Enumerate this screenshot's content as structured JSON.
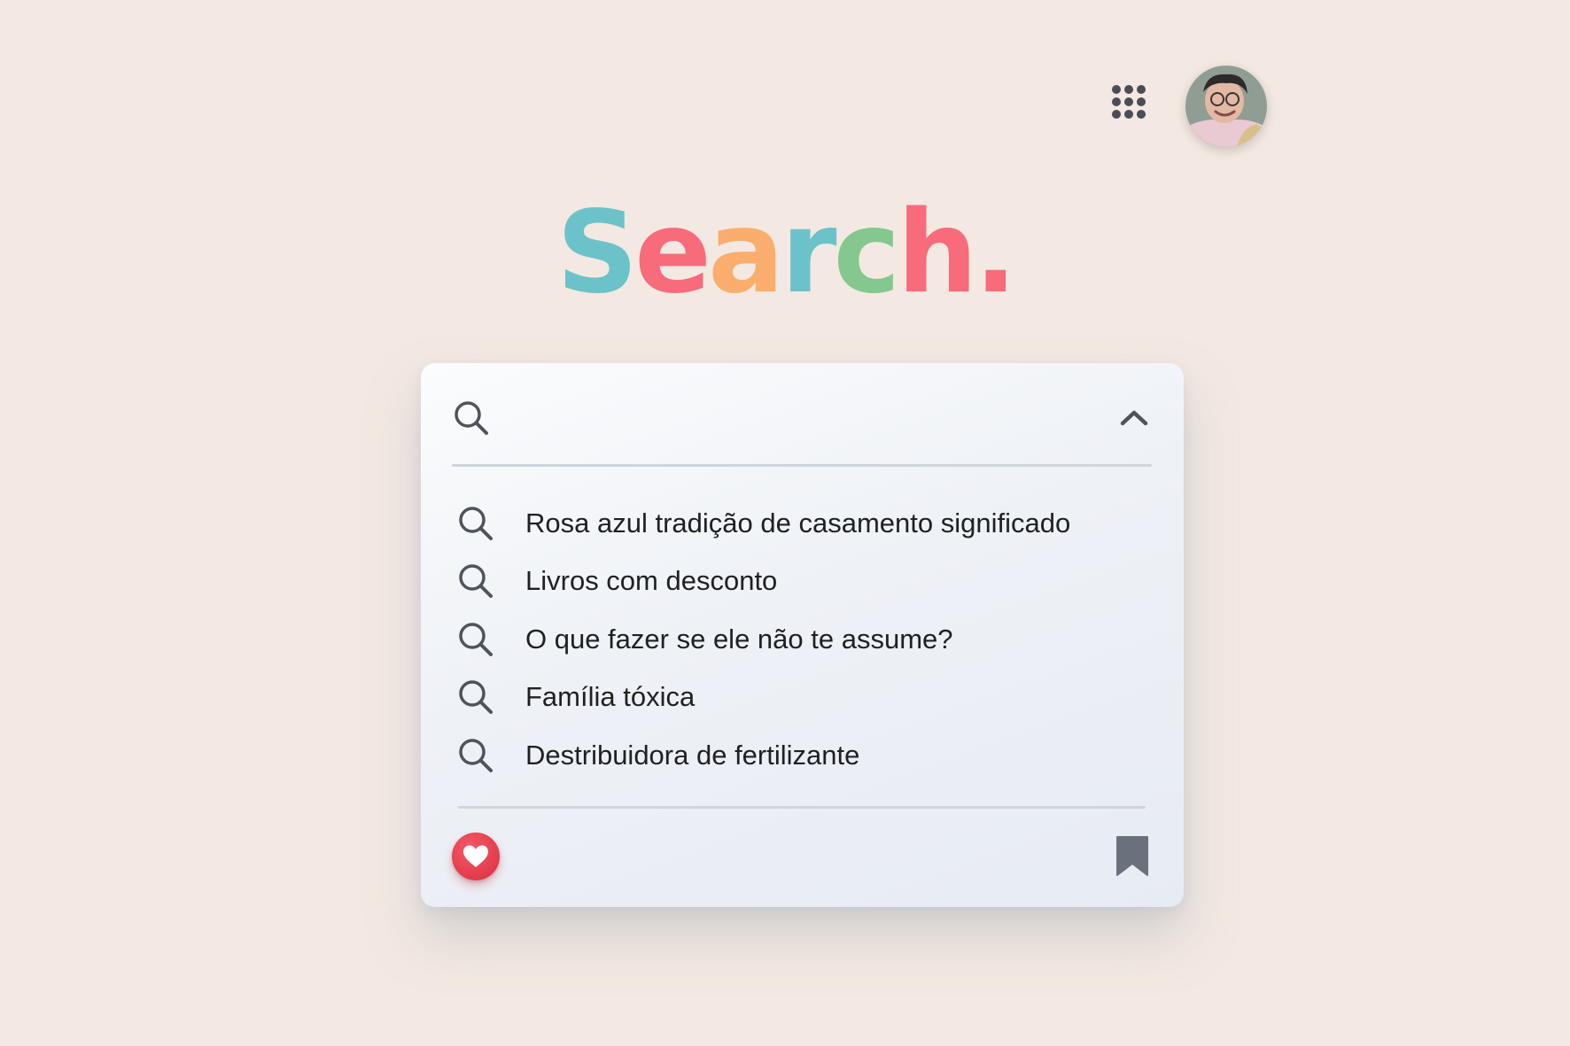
{
  "header": {
    "apps_icon": "apps-grid-icon",
    "avatar_icon": "user-avatar"
  },
  "logo": {
    "letters": [
      {
        "char": "S",
        "color": "#6cc2c9"
      },
      {
        "char": "e",
        "color": "#f76b7a"
      },
      {
        "char": "a",
        "color": "#fbad6e"
      },
      {
        "char": "r",
        "color": "#6cc2c9"
      },
      {
        "char": "c",
        "color": "#84c78f"
      },
      {
        "char": "h",
        "color": "#f76b7a"
      },
      {
        "char": ".",
        "color": "#f76b7a"
      }
    ]
  },
  "search": {
    "value": "",
    "placeholder": "",
    "icon": "search-icon",
    "collapse_icon": "chevron-up-icon"
  },
  "suggestions": [
    {
      "label": "Rosa azul tradição de casamento significado",
      "icon": "search-icon"
    },
    {
      "label": "Livros com desconto",
      "icon": "search-icon"
    },
    {
      "label": "O que fazer se ele não te assume?",
      "icon": "search-icon"
    },
    {
      "label": "Família tóxica",
      "icon": "search-icon"
    },
    {
      "label": "Destribuidora de fertilizante",
      "icon": "search-icon"
    }
  ],
  "footer": {
    "favorite_icon": "heart-icon",
    "bookmark_icon": "bookmark-icon"
  },
  "colors": {
    "background": "#f3e9e2",
    "heart": "#e23b4b",
    "icon_gray": "#4f535b",
    "bookmark": "#6b717c"
  }
}
